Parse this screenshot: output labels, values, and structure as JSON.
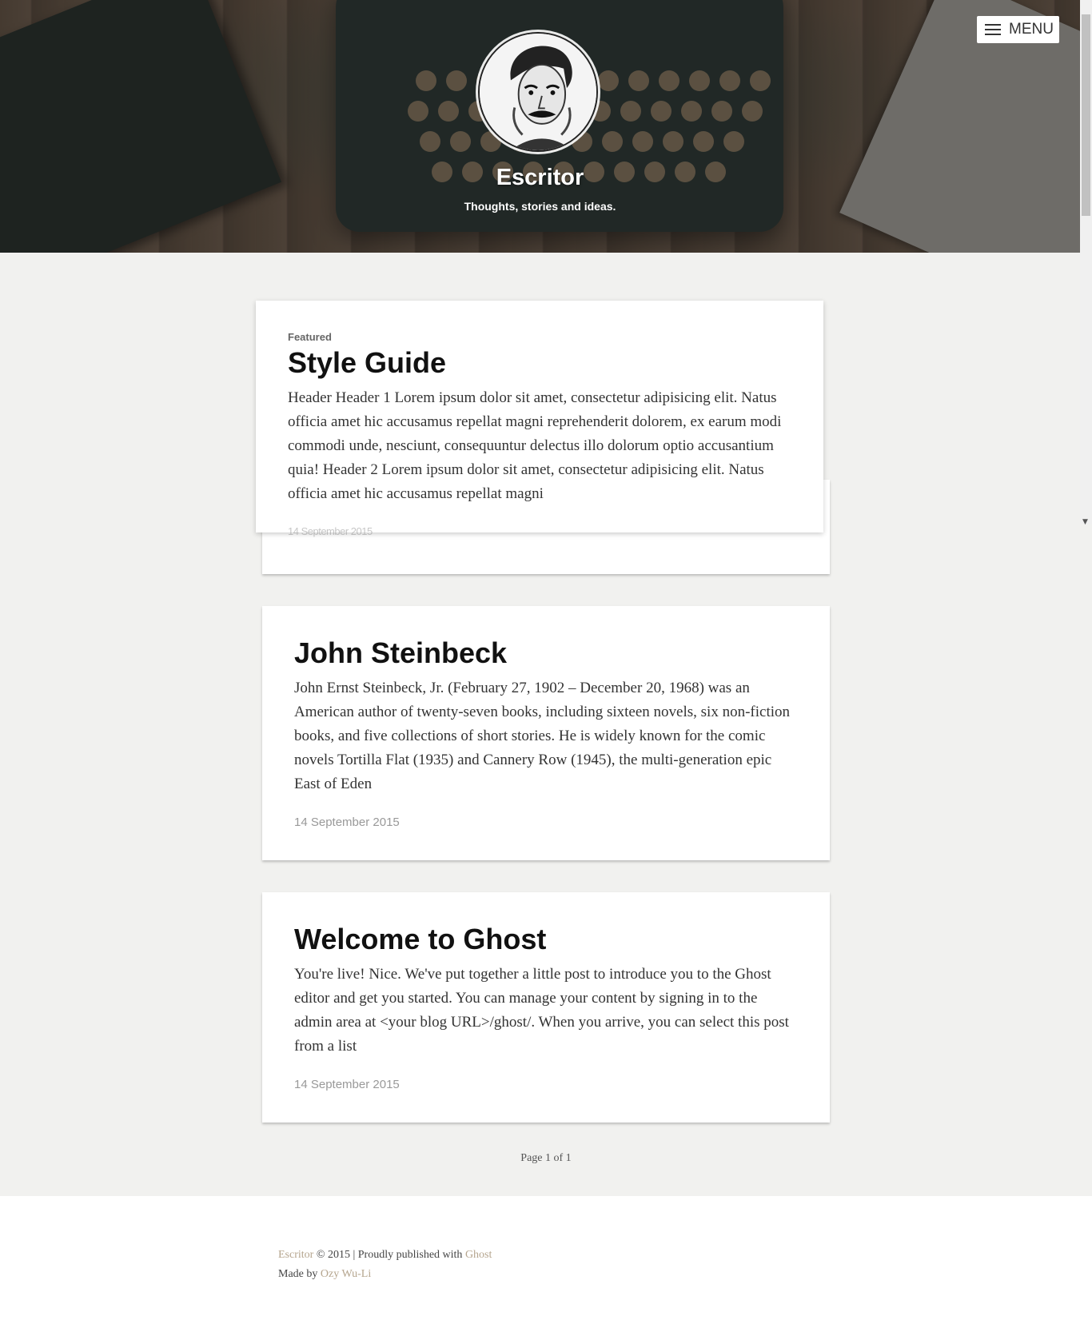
{
  "header": {
    "site_title": "Escritor",
    "site_description": "Thoughts, stories and ideas.",
    "menu_label": "MENU"
  },
  "posts": [
    {
      "label": "Featured",
      "title": "Style Guide",
      "excerpt": "Header Header 1 Lorem ipsum dolor sit amet, consectetur adipisicing elit. Natus officia amet hic accusamus repellat magni reprehenderit dolorem, ex earum modi commodi unde, nesciunt, consequuntur delectus illo dolorum optio accusantium quia! Header 2 Lorem ipsum dolor sit amet, consectetur adipisicing elit. Natus officia amet hic accusamus repellat magni",
      "date": "14 September 2015"
    },
    {
      "title": "John Steinbeck",
      "excerpt": "John Ernst Steinbeck, Jr. (February 27, 1902 – December 20, 1968) was an American author of twenty-seven books, including sixteen novels, six non-fiction books, and five collections of short stories. He is widely known for the comic novels Tortilla Flat (1935) and Cannery Row (1945), the multi-generation epic East of Eden",
      "date": "14 September 2015"
    },
    {
      "title": "Welcome to Ghost",
      "excerpt": "You're live! Nice. We've put together a little post to introduce you to the Ghost editor and get you started. You can manage your content by signing in to the admin area at <your blog URL>/ghost/. When you arrive, you can select this post from a list",
      "date": "14 September 2015"
    }
  ],
  "pagination": "Page 1 of 1",
  "footer": {
    "site_link": "Escritor",
    "copyright": " © 2015 | Proudly published with ",
    "ghost_link": "Ghost",
    "made_by": "Made by ",
    "author_link": "Ozy Wu-Li"
  },
  "icons": {
    "menu": "hamburger-icon",
    "scroll_down": "scroll-down-arrow-icon"
  }
}
